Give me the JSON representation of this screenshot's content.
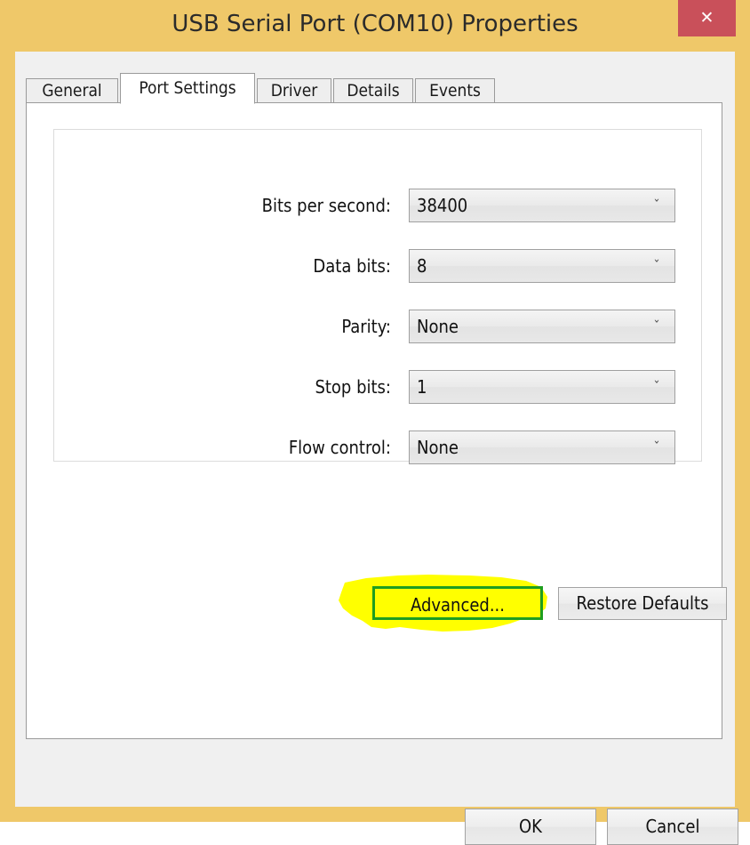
{
  "window": {
    "title": "USB Serial Port (COM10) Properties",
    "close_label": "✕",
    "frame_color": "#efc869",
    "close_color": "#c9505a"
  },
  "tabs": [
    {
      "label": "General",
      "active": false
    },
    {
      "label": "Port Settings",
      "active": true
    },
    {
      "label": "Driver",
      "active": false
    },
    {
      "label": "Details",
      "active": false
    },
    {
      "label": "Events",
      "active": false
    }
  ],
  "port_settings": {
    "fields": [
      {
        "label": "Bits per second:",
        "value": "38400",
        "arrow": "ˇ"
      },
      {
        "label": "Data bits:",
        "value": "8",
        "arrow": "ˇ"
      },
      {
        "label": "Parity:",
        "value": "None",
        "arrow": "ˇ"
      },
      {
        "label": "Stop bits:",
        "value": "1",
        "arrow": "ˇ"
      },
      {
        "label": "Flow control:",
        "value": "None",
        "arrow": "ˇ"
      }
    ],
    "advanced_label": "Advanced...",
    "restore_label": "Restore Defaults",
    "highlight": {
      "marker_color": "#ffff00",
      "outline_color": "#1e9e20"
    }
  },
  "footer": {
    "ok_label": "OK",
    "cancel_label": "Cancel"
  }
}
